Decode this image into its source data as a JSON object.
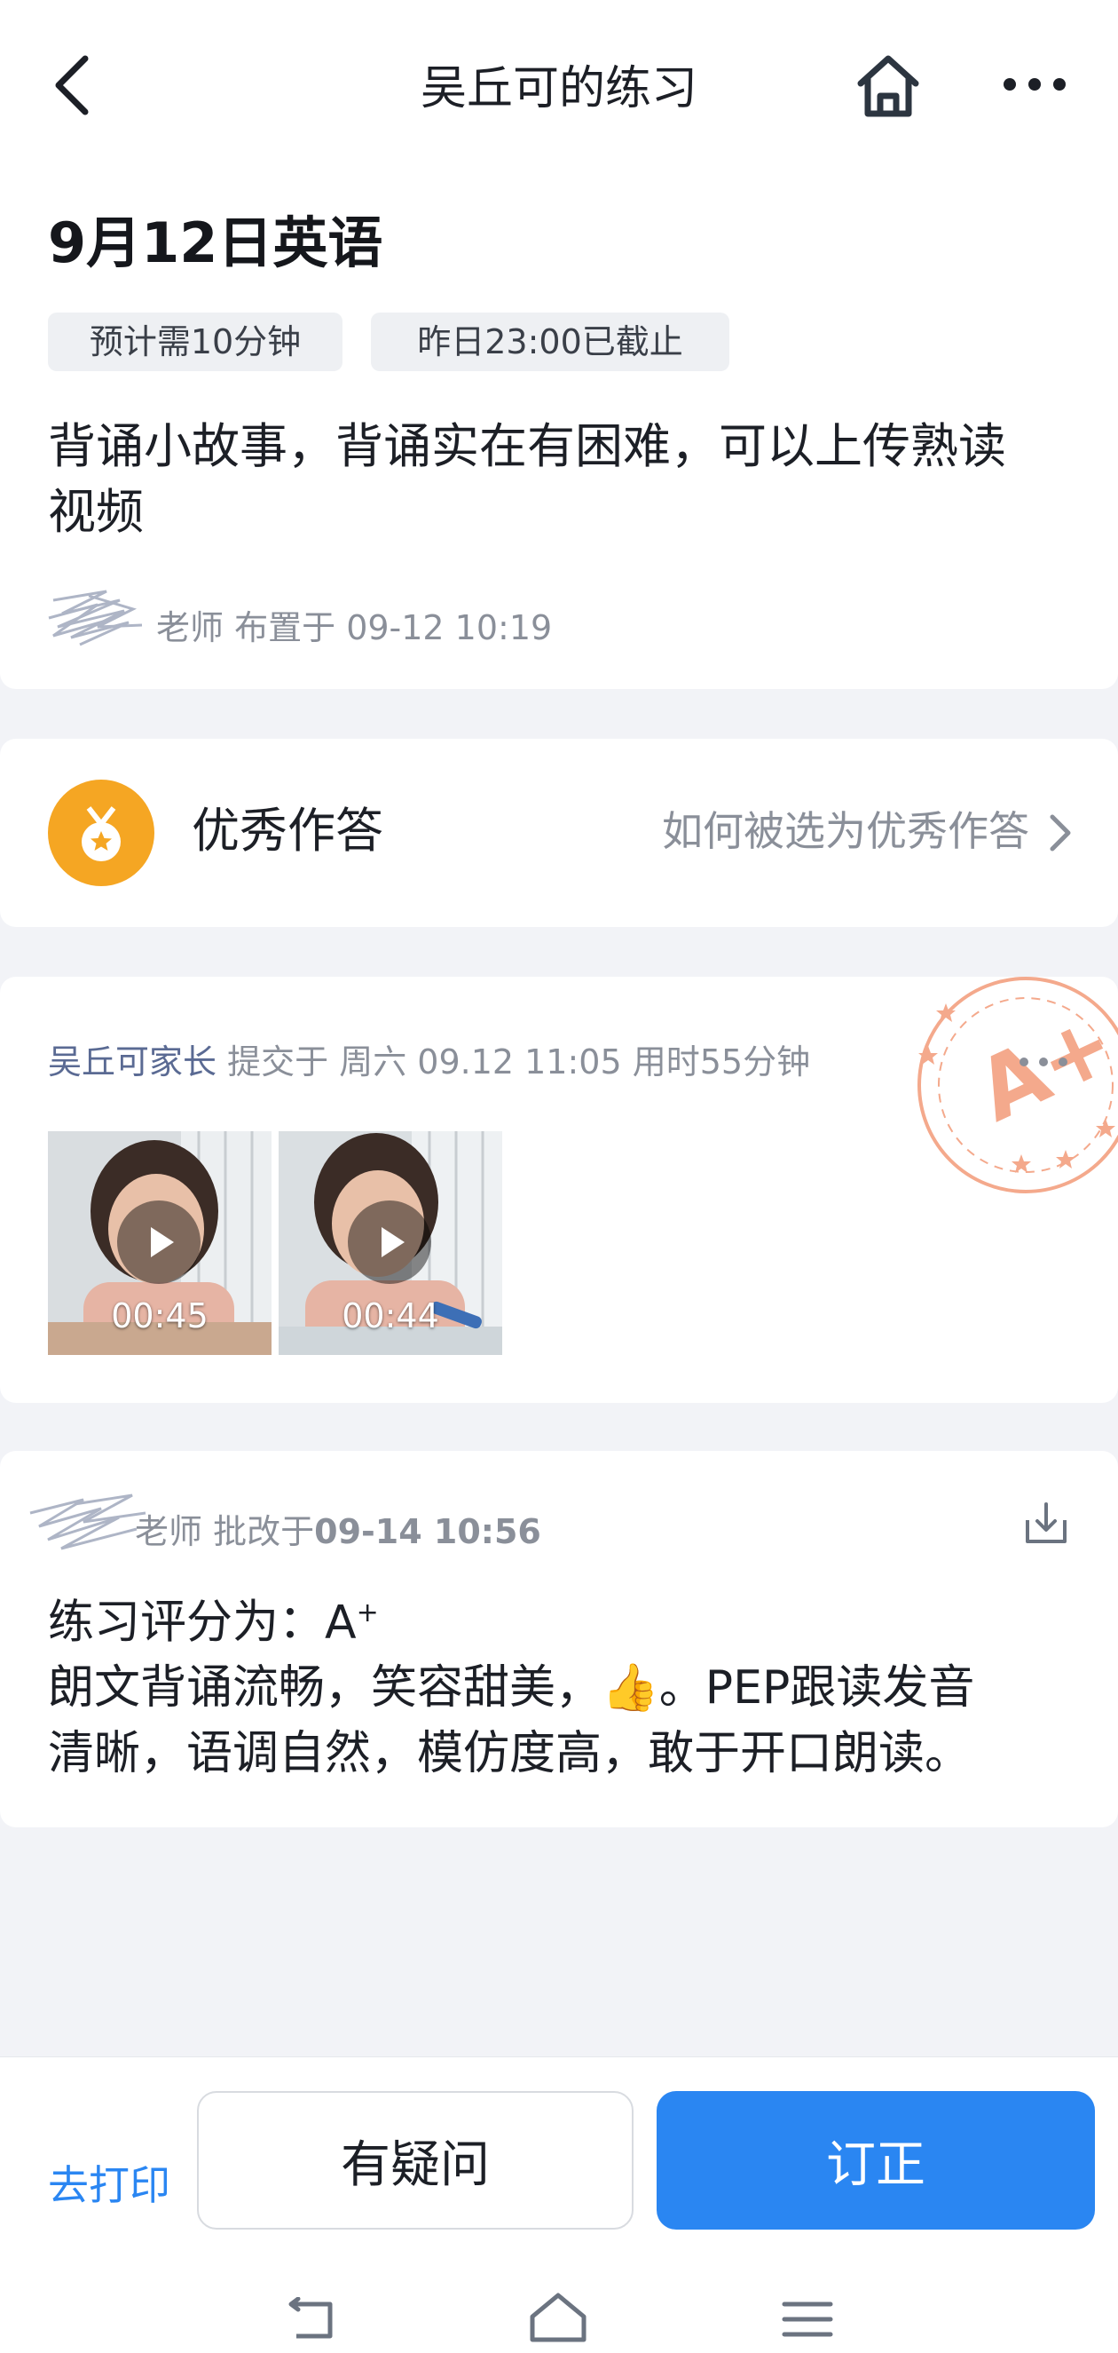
{
  "header": {
    "title": "吴丘可的练习"
  },
  "assignment": {
    "title": "9月12日英语",
    "tags": {
      "estimated_time": "预计需10分钟",
      "deadline": "昨日23:00已截止"
    },
    "description_line1": "背诵小故事，背诵实在有困难，可以上传熟读",
    "description_line2": "视频",
    "teacher_role": "老师",
    "assigned_text": "布置于 09-12 10:19"
  },
  "excellent": {
    "title": "优秀作答",
    "link": "如何被选为优秀作答"
  },
  "submission": {
    "name": "吴丘可家长",
    "meta": "提交于  周六 09.12 11:05  用时55分钟",
    "grade_stamp": "A+",
    "videos": [
      {
        "duration": "00:45"
      },
      {
        "duration": "00:44"
      }
    ]
  },
  "review": {
    "teacher_role": "老师",
    "reviewed_prefix": "批改于",
    "reviewed_time": "09-14 10:56",
    "score_label": "练习评分为：A",
    "score_sup": "+",
    "comment_line1": "朗文背诵流畅，笑容甜美，👍。PEP跟读发音",
    "comment_line2": "清晰，语调自然，模仿度高，敢于开口朗读。"
  },
  "bottom": {
    "print_label": "去打印",
    "question_label": "有疑问",
    "correct_label": "订正"
  },
  "colors": {
    "accent": "#2a86f2",
    "stamp": "#f4a98c",
    "medal": "#f5a623"
  }
}
